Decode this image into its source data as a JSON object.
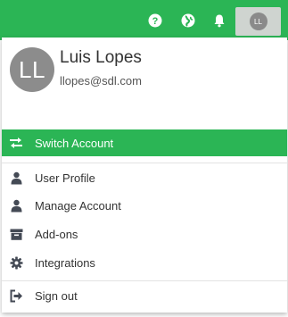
{
  "topbar": {
    "icons": [
      "help-icon",
      "globe-icon",
      "bell-icon"
    ],
    "avatar_initials": "LL"
  },
  "user": {
    "initials": "LL",
    "name": "Luis Lopes",
    "email": "llopes@sdl.com"
  },
  "menu": {
    "switch_account": {
      "label": "Switch Account",
      "icon": "exchange-icon"
    },
    "items": [
      {
        "label": "User Profile",
        "icon": "user-icon"
      },
      {
        "label": "Manage Account",
        "icon": "user-icon"
      },
      {
        "label": "Add-ons",
        "icon": "archive-icon"
      },
      {
        "label": "Integrations",
        "icon": "gear-icon"
      }
    ],
    "sign_out": {
      "label": "Sign out",
      "icon": "sign-out-icon"
    }
  },
  "colors": {
    "accent": "#2bb555",
    "avatar": "#8c8c8c"
  }
}
